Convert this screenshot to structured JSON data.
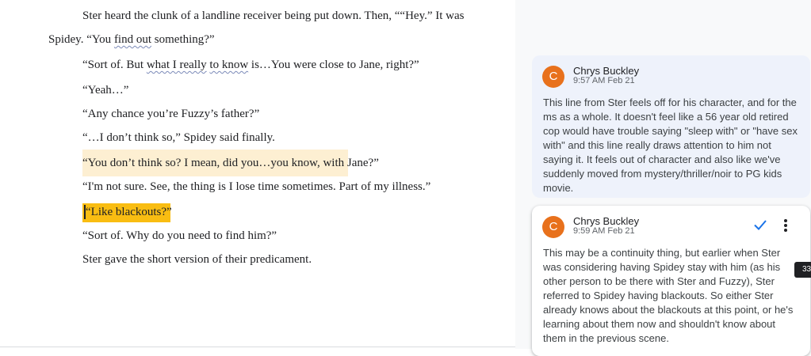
{
  "document": {
    "lines": [
      "Ster heard the clunk of a landline receiver being put down. Then, ““Hey.” It was",
      "Spidey. “You ",
      "find out",
      " something?”",
      "“Sort of. But ",
      "what I really",
      " ",
      "to know",
      " is…You were close to Jane, right?”",
      "“Yeah…”",
      "“Any chance you’re Fuzzy’s father?”",
      "“…I don’t think so,” Spidey said finally.",
      "“You don’t think so? I mean, did you…you know, with Jane?”",
      "“I'm not sure. See, the thing is I lose time sometimes. Part of my illness.”",
      "“Like blackouts?”",
      "“Sort of. Why do you need to find him?”",
      "Ster gave the short version of their predicament."
    ]
  },
  "comments": [
    {
      "avatar_letter": "C",
      "author": "Chrys Buckley",
      "time": "9:57 AM Feb 21",
      "body": "This line from Ster feels off for his character, and for the ms as a whole. It doesn't feel like a 56 year old retired cop would have trouble saying \"sleep with\" or \"have sex with\" and this line really draws attention to him not saying it. It feels out of character and also like we've suddenly moved from mystery/thriller/noir to PG kids movie."
    },
    {
      "avatar_letter": "C",
      "author": "Chrys Buckley",
      "time": "9:59 AM Feb 21",
      "body": "This may be a continuity thing, but earlier when Ster was considering having Spidey stay with him (as his other person to be there with Ster and Fuzzy), Ster referred to Spidey having blackouts. So either Ster already knows about the blackouts at this point, or he's learning about them now and shouldn't know about them in the previous scene."
    }
  ],
  "page_badge": "33",
  "colors": {
    "avatar": "#e8711c",
    "highlight_light": "#fdefd2",
    "highlight_dark": "#f9bd12",
    "resolve_check": "#1a73e8"
  },
  "icons": {
    "resolve": "check-icon",
    "more": "more-vert-icon"
  }
}
